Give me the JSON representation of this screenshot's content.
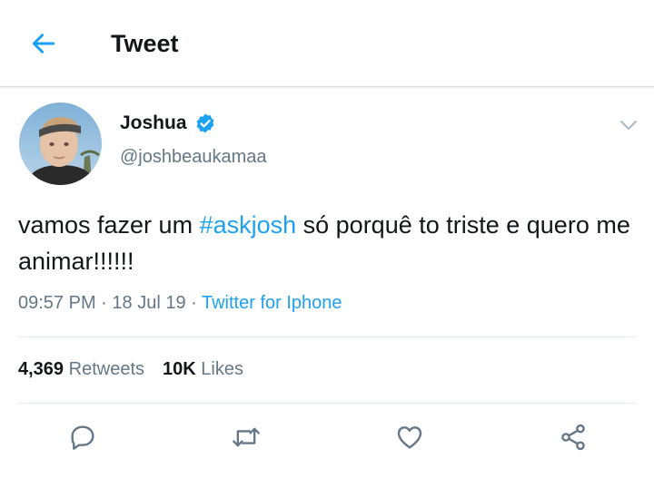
{
  "header": {
    "title": "Tweet",
    "back_icon": "arrow-left-icon",
    "accent_color": "#1da1f2"
  },
  "tweet": {
    "display_name": "Joshua",
    "verified_icon": "verified-badge-icon",
    "handle": "@joshbeaukamaa",
    "text_before": "vamos fazer um ",
    "hashtag": "#askjosh",
    "text_after": " só porquê to triste e quero me animar!!!!!!",
    "time": "09:57 PM",
    "separator": " · ",
    "date": "18 Jul 19",
    "source": "Twitter for Iphone"
  },
  "stats": {
    "retweets_count": "4,369",
    "retweets_label": "Retweets",
    "likes_count": "10K",
    "likes_label": "Likes"
  },
  "actions": {
    "reply_icon": "reply-icon",
    "retweet_icon": "retweet-icon",
    "like_icon": "heart-icon",
    "share_icon": "share-icon"
  }
}
